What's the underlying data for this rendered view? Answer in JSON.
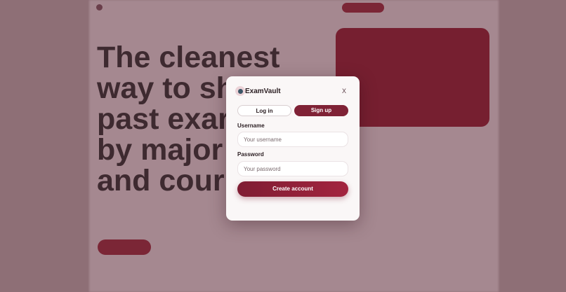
{
  "modal": {
    "brand": "ExamVault",
    "close_label": "X",
    "tabs": [
      {
        "label": "Log in",
        "active": false
      },
      {
        "label": "Sign up",
        "active": true
      }
    ],
    "username_label": "Username",
    "username_placeholder": "Your username",
    "password_label": "Password",
    "password_placeholder": "Your password",
    "submit_label": "Create account"
  },
  "background": {
    "headline_lines": [
      "The cleanest",
      "way to sh",
      "past exar",
      "by major",
      "and cour"
    ]
  },
  "colors": {
    "accent": "#7f2236",
    "overlay": "#8e6f76",
    "modal_bg": "#faf7f7"
  }
}
